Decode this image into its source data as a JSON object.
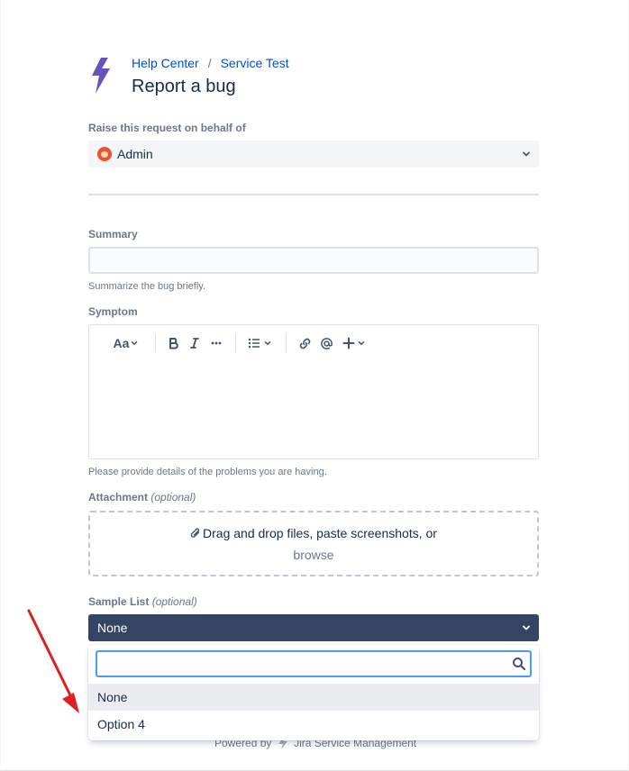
{
  "breadcrumb": {
    "home": "Help Center",
    "separator": "/",
    "project": "Service Test"
  },
  "page_title": "Report a bug",
  "behalf": {
    "label": "Raise this request on behalf of",
    "value": "Admin"
  },
  "summary": {
    "label": "Summary",
    "value": "",
    "help": "Summarize the bug briefly."
  },
  "symptom": {
    "label": "Symptom",
    "help": "Please provide details of the problems you are having.",
    "toolbar": {
      "text_style": "Aa"
    }
  },
  "attachment": {
    "label": "Attachment",
    "optional": "(optional)",
    "drop_text": "Drag and drop files, paste screenshots, or",
    "browse": "browse"
  },
  "sample_list": {
    "label": "Sample List",
    "optional": "(optional)",
    "value": "None",
    "search_value": "",
    "options": [
      "None",
      "Option 4"
    ]
  },
  "footer": {
    "prefix": "Powered by",
    "product": "Jira Service Management"
  },
  "colors": {
    "link": "#0052cc",
    "logo": "#6554c0",
    "select_active": "#344563",
    "focus": "#4c9aff",
    "annotation_arrow": "#e02020"
  },
  "icons": [
    "lightning-bolt-logo",
    "chevron-down-icon",
    "bold-icon",
    "italic-icon",
    "more-icon",
    "bullet-list-icon",
    "link-icon",
    "mention-icon",
    "plus-icon",
    "paperclip-icon",
    "search-icon"
  ]
}
